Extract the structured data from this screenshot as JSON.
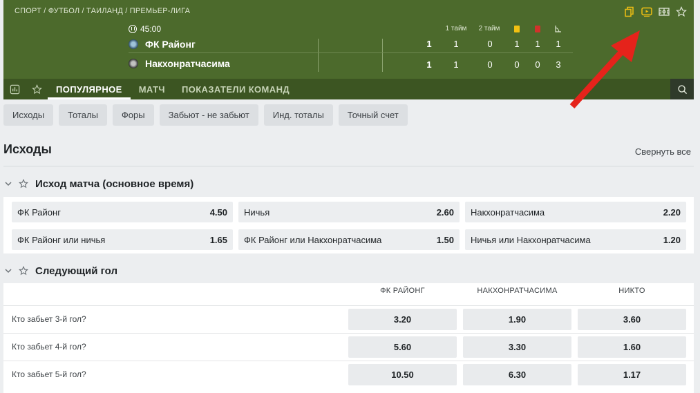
{
  "breadcrumb": "СПОРТ / ФУТБОЛ / ТАИЛАНД / ПРЕМЬЕР-ЛИГА",
  "header_icons": [
    "copy-icon",
    "video-icon",
    "field-icon",
    "star-icon"
  ],
  "match": {
    "time": "45:00",
    "columns": {
      "half1": "1 тайм",
      "half2": "2 тайм"
    },
    "home": {
      "name": "ФК Районг",
      "total": "1",
      "h1": "1",
      "h2": "0",
      "yellow": "1",
      "red": "1",
      "corners": "1"
    },
    "away": {
      "name": "Накхонратчасима",
      "total": "1",
      "h1": "1",
      "h2": "0",
      "yellow": "0",
      "red": "0",
      "corners": "3"
    }
  },
  "tabs": [
    "ПОПУЛЯРНОЕ",
    "МАТЧ",
    "ПОКАЗАТЕЛИ КОМАНД"
  ],
  "chips": [
    "Исходы",
    "Тоталы",
    "Форы",
    "Забьют - не забьют",
    "Инд. тоталы",
    "Точный счет"
  ],
  "section": {
    "title": "Исходы",
    "collapse_all": "Свернуть все"
  },
  "market1": {
    "title": "Исход матча (основное время)",
    "odds": [
      {
        "label": "ФК Районг",
        "value": "4.50"
      },
      {
        "label": "Ничья",
        "value": "2.60"
      },
      {
        "label": "Накхонратчасима",
        "value": "2.20"
      },
      {
        "label": "ФК Районг или ничья",
        "value": "1.65"
      },
      {
        "label": "ФК Районг или Накхонратчасима",
        "value": "1.50"
      },
      {
        "label": "Ничья или Накхонратчасима",
        "value": "1.20"
      }
    ]
  },
  "market2": {
    "title": "Следующий гол",
    "columns": [
      "ФК РАЙОНГ",
      "НАКХОНРАТЧАСИМА",
      "НИКТО"
    ],
    "rows": [
      {
        "q": "Кто забьет 3-й гол?",
        "v": [
          "3.20",
          "1.90",
          "3.60"
        ]
      },
      {
        "q": "Кто забьет 4-й гол?",
        "v": [
          "5.60",
          "3.30",
          "1.60"
        ]
      },
      {
        "q": "Кто забьет 5-й гол?",
        "v": [
          "10.50",
          "6.30",
          "1.17"
        ]
      }
    ]
  },
  "colors": {
    "header": "#4c6a2c",
    "tabbar": "#3c5522",
    "accent": "#f2c012",
    "arrow": "#e5231b"
  }
}
